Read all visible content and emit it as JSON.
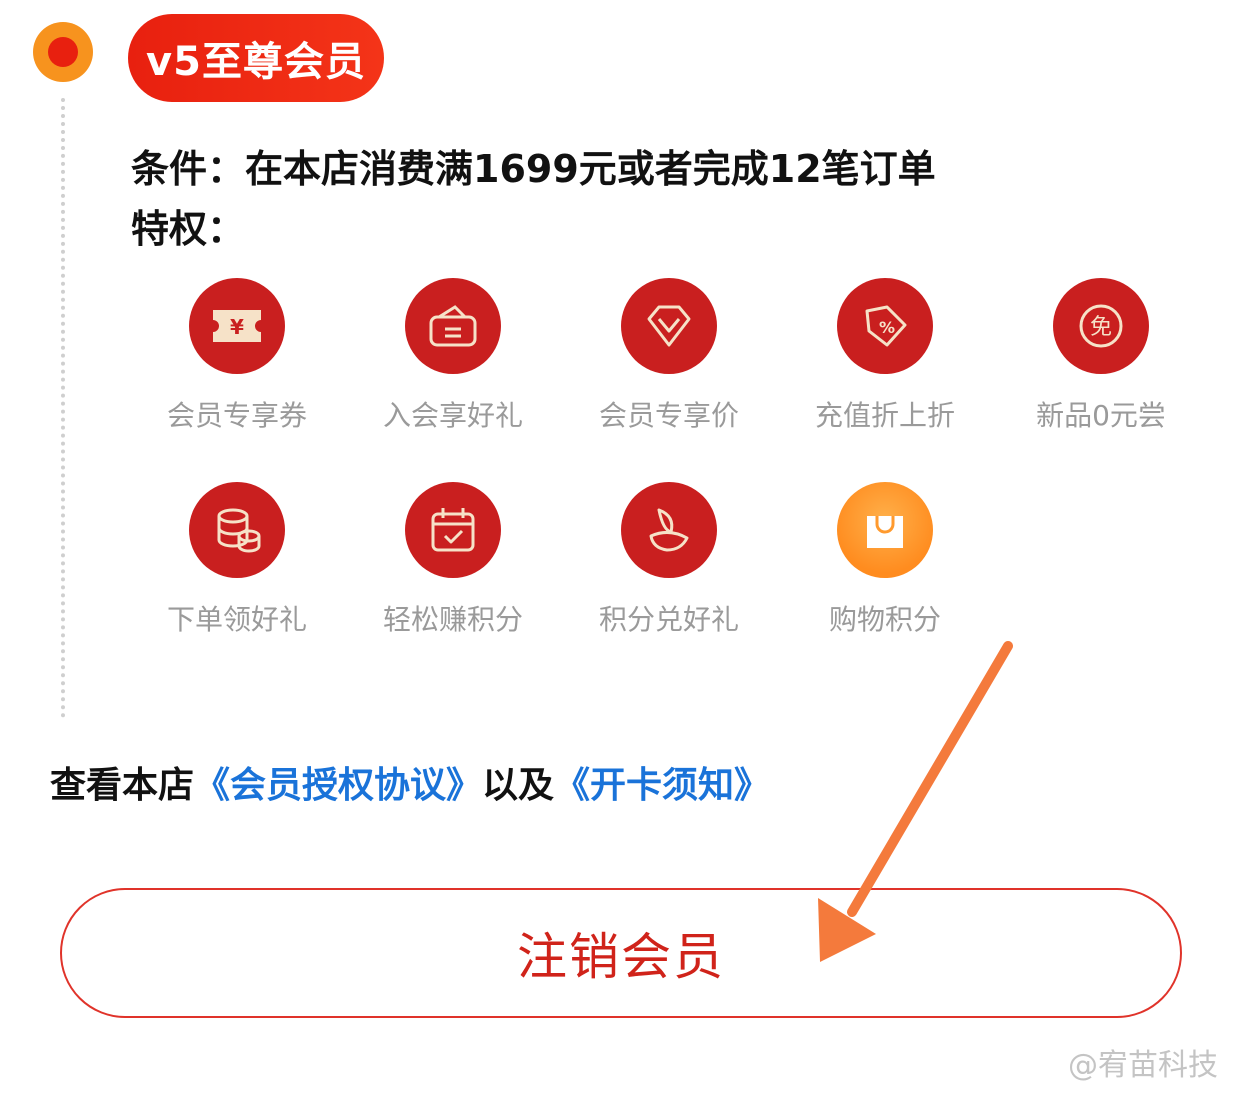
{
  "level": {
    "badge": "v5至尊会员"
  },
  "condition_text": "条件：在本店消费满1699元或者完成12笔订单",
  "privilege_title": "特权：",
  "perks": [
    {
      "label": "会员专享券",
      "icon": "coupon-icon"
    },
    {
      "label": "入会享好礼",
      "icon": "wallet-icon"
    },
    {
      "label": "会员专享价",
      "icon": "diamond-icon"
    },
    {
      "label": "充值折上折",
      "icon": "discount-tag-icon"
    },
    {
      "label": "新品0元尝",
      "icon": "free-icon"
    },
    {
      "label": "下单领好礼",
      "icon": "coins-icon"
    },
    {
      "label": "轻松赚积分",
      "icon": "calendar-check-icon"
    },
    {
      "label": "积分兑好礼",
      "icon": "gift-icon"
    },
    {
      "label": "购物积分",
      "icon": "shopping-bag-icon"
    }
  ],
  "agreement": {
    "prefix": "查看本店",
    "link1": "《会员授权协议》",
    "middle": "以及",
    "link2": "《开卡须知》"
  },
  "cancel_button": "注销会员",
  "watermark": "@宥苗科技",
  "colors": {
    "brand_red": "#e8200f",
    "icon_red": "#c91f1f",
    "link_blue": "#1a73d9",
    "arrow_orange": "#f47a3c"
  }
}
